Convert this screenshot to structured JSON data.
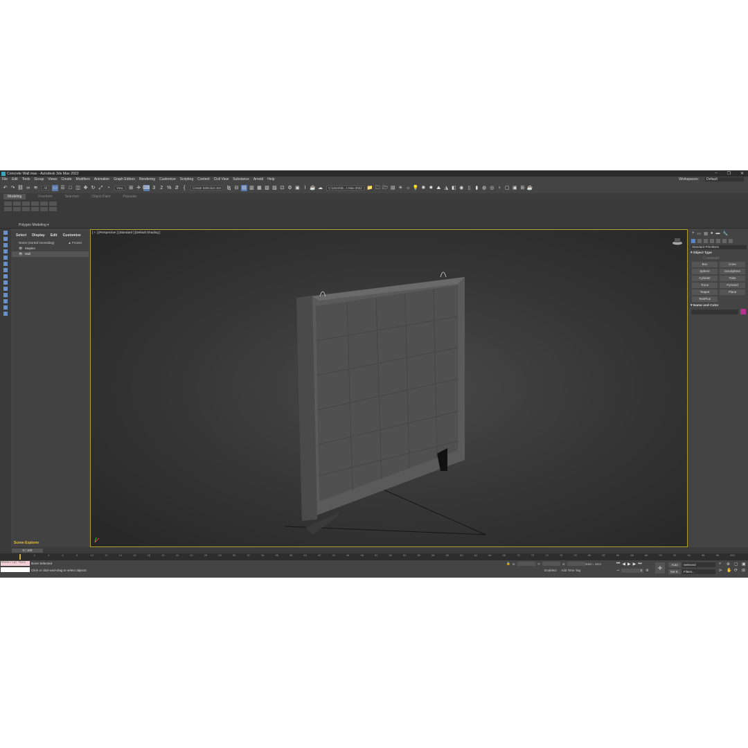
{
  "window": {
    "title": "Concrete Wall.max - Autodesk 3ds Max 2022",
    "controls": [
      "‒",
      "❐",
      "✕"
    ]
  },
  "menu": [
    "File",
    "Edit",
    "Tools",
    "Group",
    "Views",
    "Create",
    "Modifiers",
    "Animation",
    "Graph Editors",
    "Rendering",
    "Customize",
    "Scripting",
    "Content",
    "Civil View",
    "Substance",
    "Arnold",
    "Help"
  ],
  "workspace": {
    "label": "Workspaces:",
    "value": "Default"
  },
  "toolbar": {
    "filter": "All",
    "view": "View",
    "selection_set": "Create Selection Set",
    "path": "C:\\Users\\B...s Max 2022",
    "snap_label": "3",
    "angle_label": "2",
    "percent_label": "%"
  },
  "ribbon": {
    "tabs": [
      "Modeling",
      "Freeform",
      "Selection",
      "Object Paint",
      "Populate"
    ],
    "panel_label": "Polygon Modeling"
  },
  "scene_explorer": {
    "tabs": [
      "Select",
      "Display",
      "Edit",
      "Customize"
    ],
    "header_name": "Name (Sorted Ascending)",
    "header_frozen": "▲ Frozen",
    "rows": [
      "Staples",
      "Wall"
    ],
    "footer_label": "Scene Explorer"
  },
  "viewport": {
    "label": "[ + ] [Perspective ] [Standard ] [Default Shading ]"
  },
  "command_panel": {
    "dropdown": "Standard Primitives",
    "object_type_title": "Object Type",
    "autogrid": "AutoGrid",
    "buttons": [
      "Box",
      "Cone",
      "Sphere",
      "GeoSphere",
      "Cylinder",
      "Tube",
      "Torus",
      "Pyramid",
      "Teapot",
      "Plane",
      "TextPlus"
    ],
    "name_color_title": "Name and Color"
  },
  "timeline": {
    "frame": "0 / 100",
    "ticks": [
      "0",
      "2",
      "4",
      "6",
      "8",
      "10",
      "12",
      "14",
      "16",
      "18",
      "20",
      "22",
      "24",
      "26",
      "28",
      "30",
      "32",
      "34",
      "36",
      "38",
      "40",
      "42",
      "44",
      "46",
      "48",
      "50",
      "52",
      "54",
      "56",
      "58",
      "60",
      "62",
      "64",
      "66",
      "68",
      "70",
      "72",
      "74",
      "76",
      "78",
      "80",
      "82",
      "84",
      "86",
      "88",
      "90",
      "92",
      "94",
      "96",
      "98",
      "100"
    ]
  },
  "status": {
    "maxscript": "MAXScript Mini",
    "selection": "None Selected",
    "prompt": "Click or click-and-drag to select objects",
    "x_label": "X:",
    "y_label": "Y:",
    "z_label": "Z:",
    "grid": "Grid = 10,0",
    "enabled": "Enabled:",
    "add_time_tag": "Add Time Tag",
    "auto": "Auto",
    "set_k": "Set K.",
    "selected": "Selected",
    "filters": "Filters...",
    "frame_field": "0"
  }
}
